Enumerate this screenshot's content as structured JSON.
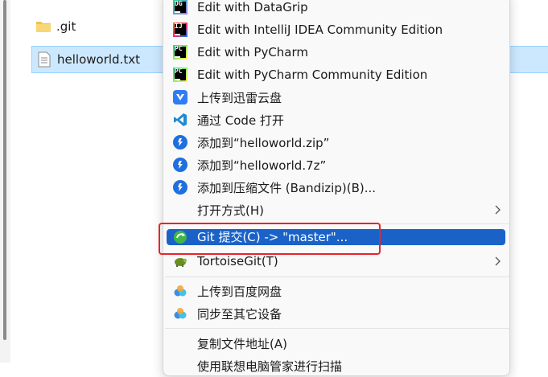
{
  "explorer": {
    "files": [
      {
        "name": ".git",
        "icon": "folder-icon",
        "selected": false
      },
      {
        "name": "helloworld.txt",
        "icon": "text-file-icon",
        "selected": true
      }
    ]
  },
  "context_menu": {
    "items": [
      {
        "label": "Edit with DataGrip",
        "icon": "datagrip-icon"
      },
      {
        "label": "Edit with IntelliJ IDEA Community Edition",
        "icon": "intellij-idea-icon"
      },
      {
        "label": "Edit with PyCharm",
        "icon": "pycharm-icon"
      },
      {
        "label": "Edit with PyCharm Community Edition",
        "icon": "pycharm-community-icon"
      },
      {
        "label": "上传到迅雷云盘",
        "icon": "xunlei-cloud-icon"
      },
      {
        "label": "通过 Code 打开",
        "icon": "vscode-icon"
      },
      {
        "label": "添加到“helloworld.zip”",
        "icon": "bandizip-icon"
      },
      {
        "label": "添加到“helloworld.7z”",
        "icon": "bandizip-icon"
      },
      {
        "label": "添加到压缩文件 (Bandizip)(B)...",
        "icon": "bandizip-icon"
      },
      {
        "label": "打开方式(H)",
        "has_submenu": true
      },
      {
        "label": "Git 提交(C) -> \"master\"...",
        "icon": "tortoisegit-commit-icon",
        "highlighted": true
      },
      {
        "label": "TortoiseGit(T)",
        "icon": "tortoisegit-icon",
        "has_submenu": true
      },
      {
        "label": "上传到百度网盘",
        "icon": "baidu-netdisk-icon"
      },
      {
        "label": "同步至其它设备",
        "icon": "baidu-netdisk-icon"
      },
      {
        "label": "复制文件地址(A)"
      },
      {
        "label": "使用联想电脑管家进行扫描"
      }
    ]
  },
  "colors": {
    "highlight": "#1a62c8",
    "selection": "#cce8ff",
    "callout_border": "#e8242a",
    "pycharm_green": "#21d789",
    "vscode_blue": "#1f8ad2"
  }
}
